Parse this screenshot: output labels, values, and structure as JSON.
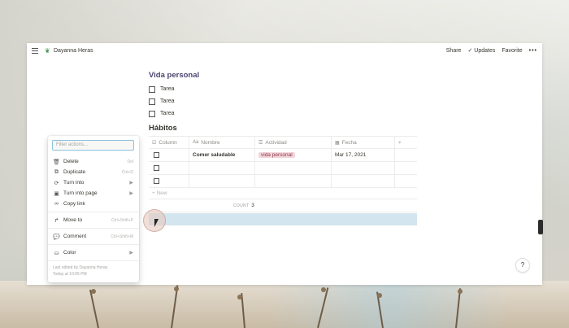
{
  "topbar": {
    "workspace_title": "Dayanna Heras",
    "share_label": "Share",
    "updates_label": "✓ Updates",
    "favorite_label": "Favorite",
    "more_label": "•••"
  },
  "content": {
    "section_title": "Vida personal",
    "todos": [
      "Tarea",
      "Tarea",
      "Tarea"
    ],
    "habits_title": "Hábitos"
  },
  "table": {
    "columns": [
      "Column",
      "Nombre",
      "Actividad",
      "Fecha",
      "+"
    ],
    "rows": [
      {
        "nombre": "Comer saludable",
        "actividad": "vida personal",
        "fecha": "Mar 17, 2021"
      },
      {
        "nombre": "",
        "actividad": "",
        "fecha": ""
      },
      {
        "nombre": "",
        "actividad": "",
        "fecha": ""
      }
    ],
    "new_label": "+ New",
    "count_label": "COUNT",
    "count_value": "3",
    "tag_color": "#f3d6db"
  },
  "menu": {
    "filter_placeholder": "Filter actions...",
    "items": [
      {
        "label": "Delete",
        "shortcut": "Del"
      },
      {
        "label": "Duplicate",
        "shortcut": "Ctrl+D"
      },
      {
        "label": "Turn into",
        "shortcut": "▶"
      },
      {
        "label": "Turn into page",
        "shortcut": "▶"
      },
      {
        "label": "Copy link",
        "shortcut": ""
      },
      {
        "label": "Move to",
        "shortcut": "Ctrl+Shift+P"
      },
      {
        "label": "Comment",
        "shortcut": "Ctrl+Shift+M"
      },
      {
        "label": "Color",
        "shortcut": "▶"
      }
    ],
    "footer_line1": "Last edited by Dayanna Heras",
    "footer_line2": "Today at 10:05 PM"
  },
  "help_label": "?",
  "colors": {
    "accent": "#8fc1df",
    "selection": "#d3e5ef",
    "heading": "#4a4670"
  }
}
